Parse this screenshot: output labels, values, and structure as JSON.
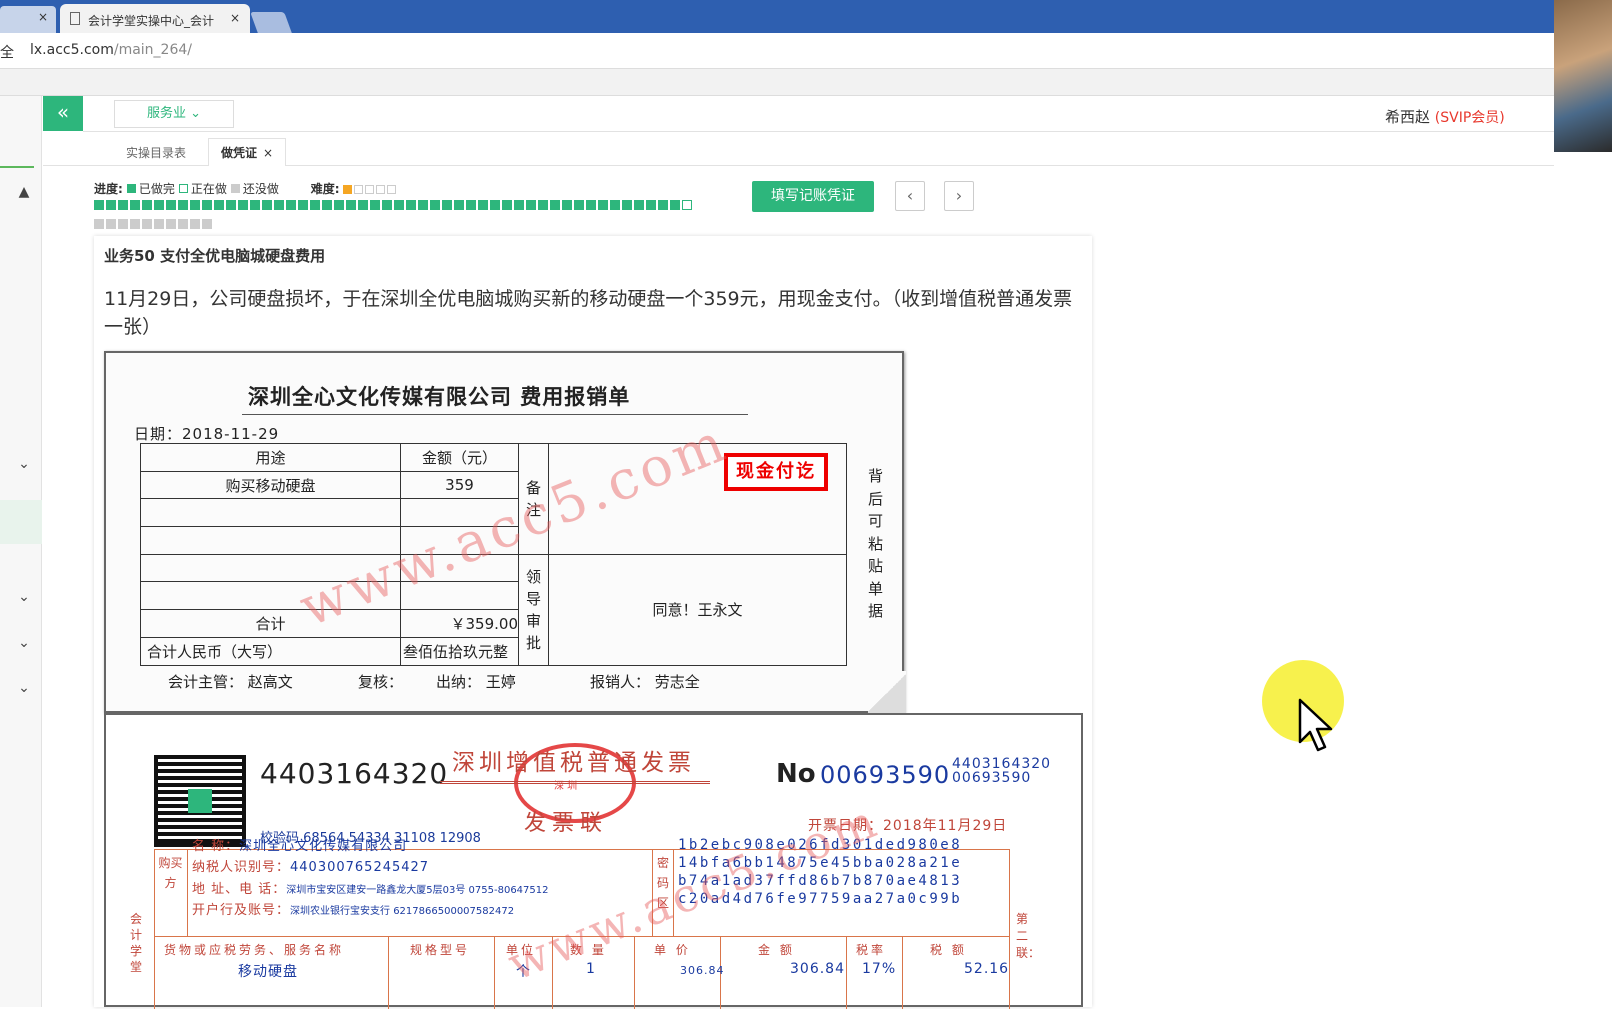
{
  "browser": {
    "prev_tab_close": "×",
    "tab_title": "会计学堂实操中心_会计",
    "tab_close": "×",
    "address_prefix": "全",
    "url_host": "lx.acc5.com",
    "url_path": "/main_264/"
  },
  "header": {
    "collapse": "«",
    "industry": "服务业 ⌄",
    "user_name": "希西赵",
    "user_level": "(SVIP会员)"
  },
  "tabs": {
    "catalog": "实操目录表",
    "voucher": "做凭证",
    "voucher_close": "×"
  },
  "progress": {
    "label": "进度:",
    "done": "已做完",
    "doing": "正在做",
    "todo": "还没做",
    "difficulty": "难度:",
    "difficulty_level": 1,
    "difficulty_max": 5,
    "done_count": 49,
    "current_index": 50,
    "total_rows": 60
  },
  "actions": {
    "fill_voucher": "填写记账凭证",
    "prev": "‹",
    "next": "›"
  },
  "business": {
    "title": "业务50 支付全优电脑城硬盘费用",
    "description": "11月29日，公司硬盘损坏，于在深圳全优电脑城购买新的移动硬盘一个359元，用现金支付。（收到增值税普通发票一张）"
  },
  "voucher": {
    "title": "深圳全心文化传媒有限公司 费用报销单",
    "date": "日期：2018-11-29",
    "col_purpose": "用途",
    "col_amount": "金额（元）",
    "rows": [
      {
        "purpose": "购买移动硬盘",
        "amount": "359"
      },
      {
        "purpose": "",
        "amount": ""
      },
      {
        "purpose": "",
        "amount": ""
      },
      {
        "purpose": "",
        "amount": ""
      },
      {
        "purpose": "",
        "amount": ""
      }
    ],
    "total_label": "合计",
    "total_value": "￥359.00",
    "rmb_label": "合计人民币（大写）",
    "rmb_value": "叁佰伍拾玖元整",
    "remark_label": "备注",
    "approve_label": "领导审批",
    "approve_text": "同意！王永文",
    "cash_stamp": "现金付讫",
    "side_note": "背后可粘贴单据",
    "supervisor": "会计主管：  赵高文",
    "reviewer": "复核：",
    "cashier": "出纳：  王婷",
    "claimant": "报销人：  劳志全",
    "watermark": "www.acc5.com"
  },
  "invoice": {
    "code": "4403164320",
    "check_code": "校验码 68564 54334 31108 12908",
    "title": "深圳增值税普通发票",
    "copy": "发票联",
    "stamp_text": "深  圳",
    "no_label": "No",
    "number": "00693590",
    "small_code": "4403164320",
    "small_number": "00693590",
    "date_label": "开票日期：",
    "date": "2018年11月29日",
    "buyer_side": "购买方",
    "buyer_name_label": "名        称：",
    "buyer_name": "深圳全心文化传媒有限公司",
    "buyer_tax_label": "纳税人识别号：",
    "buyer_tax": "440300765245427",
    "buyer_addr_label": "地  址、电  话：",
    "buyer_addr": "深圳市宝安区建安一路鑫龙大厦5层03号 0755-80647512",
    "buyer_bank_label": "开户行及账号：",
    "buyer_bank": "深圳农业银行宝安支行 6217866500007582472",
    "cipher_side": "密码区",
    "cipher": [
      "1b2ebc908e026fd301ded980e8",
      "14bfa6bb14875e45bba028a21e",
      "b74a1ad37ffd86b7b870ae4813",
      "c20ad4d76fe97759aa27a0c99b"
    ],
    "col_goods": "货物或应税劳务、服务名称",
    "col_spec": "规格型号",
    "col_unit": "单位",
    "col_qty": "数 量",
    "col_price": "单 价",
    "col_amount": "金  额",
    "col_rate": "税率",
    "col_tax": "税  额",
    "item_name": "移动硬盘",
    "item_unit": "个",
    "item_qty": "1",
    "item_price": "306.84",
    "item_amount": "306.84",
    "item_rate": "17%",
    "item_tax": "52.16",
    "left_vertical": "会计学堂",
    "right_vertical": "第二联：",
    "watermark": "www.acc5.com"
  },
  "colors": {
    "accent": "#2db67c",
    "vip": "#e8382d",
    "stamp": "#e00000",
    "invoice_red": "#c0463a",
    "invoice_blue": "#1a3aa0"
  }
}
